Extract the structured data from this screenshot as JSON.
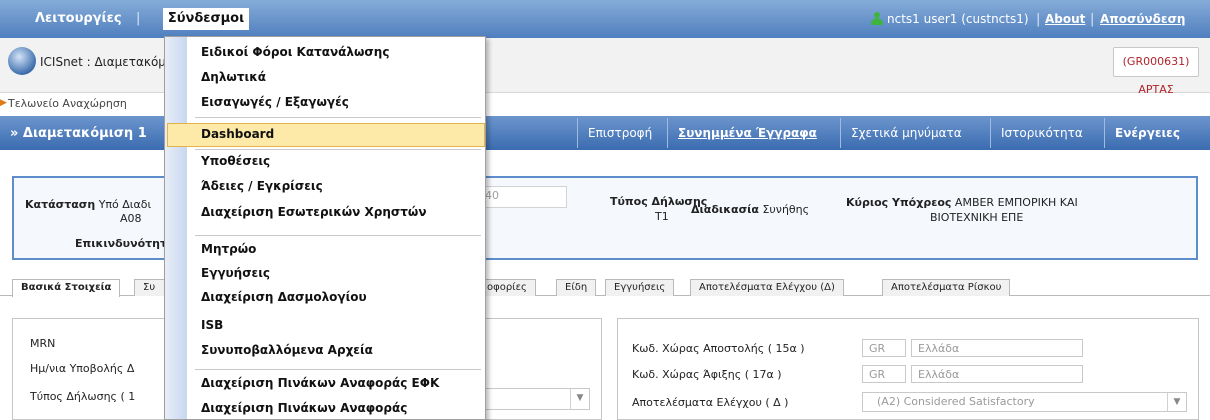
{
  "topbar": {
    "menu_leitourgies": "Λειτουργίες",
    "menu_sindesmoi": "Σύνδεσμοι",
    "user_text": "ncts1 user1 (custncts1)",
    "about": "About",
    "logout": "Αποσύνδεση",
    "separator": "|"
  },
  "app": {
    "title": "ICISnet : Διαμετακόμιση",
    "customs_office": "(GR000631) ΑΡΤΑΣ",
    "breadcrumb": "Τελωνείο Αναχώρηση"
  },
  "titlebar": {
    "page_title": "» Διαμετακόμιση 1",
    "buttons": [
      "Επιστροφή",
      "Συνημμένα Έγγραφα",
      "Σχετικά μηνύματα",
      "Ιστορικότητα",
      "Ενέργειες"
    ]
  },
  "summary": {
    "status_label": "Κατάσταση",
    "status_value": "Υπό Διαδι",
    "status_code": "A08",
    "risk_label": "Επικινδυνότητ",
    "ref_fragment": "40",
    "type_label": "Τύπος Δήλωσης",
    "type_value": "T1",
    "procedure_label": "Διαδικασία",
    "procedure_value": "Συνήθης",
    "principal_label": "Κύριος Υπόχρεος",
    "principal_value_1": "AMBER ΕΜΠΟΡΙΚΗ ΚΑΙ",
    "principal_value_2": "ΒΙΟΤΕΧΝΙΚΗ ΕΠΕ"
  },
  "tabs": {
    "basic": "Βασικά Στοιχεία",
    "su": "Συ",
    "transport": "οφορίες",
    "items": "Είδη",
    "guarantees": "Εγγυήσεις",
    "control_results": "Αποτελέσματα Ελέγχου (Δ)",
    "risk_results": "Αποτελέσματα Ρίσκου"
  },
  "left_form": {
    "mrn": "MRN",
    "submission_date": "Ημ/νια Υποβολής Δ",
    "declaration_type": "Τύπος Δήλωσης ( 1"
  },
  "right_form": {
    "dispatch_label": "Κωδ. Χώρας Αποστολής ( 15α )",
    "dispatch_code": "GR",
    "dispatch_country": "Ελλάδα",
    "destination_label": "Κωδ. Χώρας Άφιξης ( 17α )",
    "destination_code": "GR",
    "destination_country": "Ελλάδα",
    "control_label": "Αποτελέσματα Ελέγχου ( Δ )",
    "control_value": "(A2) Considered Satisfactory"
  },
  "dropdown": {
    "items": [
      "Ειδικοί Φόροι Κατανάλωσης",
      "Δηλωτικά",
      "Εισαγωγές / Εξαγωγές",
      "Dashboard",
      "Υποθέσεις",
      "Άδειες / Εγκρίσεις",
      "Διαχείριση Εσωτερικών Χρηστών",
      "Μητρώο",
      "Εγγυήσεις",
      "Διαχείριση Δασμολογίου",
      "ISB",
      "Συνυποβαλλόμενα Αρχεία",
      "Διαχείριση Πινάκων Αναφοράς ΕΦΚ",
      "Διαχείριση Πινάκων Αναφοράς"
    ]
  },
  "colors": {
    "topbar": "#4f7fbf",
    "highlight": "#fde9a8",
    "customs_red": "#b1242b"
  },
  "icons": {
    "user": "user-icon",
    "logo": "icisnet-logo-icon",
    "chevron": "chevron-down-icon"
  }
}
